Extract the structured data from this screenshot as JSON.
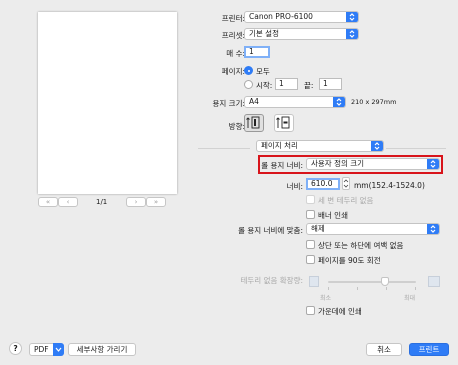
{
  "preview": {
    "page_indicator": "1/1",
    "first_page_glyph": "«",
    "prev_page_glyph": "‹",
    "next_page_glyph": "›",
    "last_page_glyph": "»"
  },
  "printer": {
    "label": "프린터:",
    "value": "Canon PRO-6100"
  },
  "preset": {
    "label": "프리셋:",
    "value": "기본 설정"
  },
  "copies": {
    "label": "매 수:",
    "value": "1"
  },
  "pages": {
    "label": "페이지:",
    "all_label": "모두",
    "from_label": "시작:",
    "from_value": "1",
    "to_label": "끝:",
    "to_value": "1"
  },
  "paper_size": {
    "label": "용지 크기:",
    "value": "A4",
    "dimensions": "210 x 297mm"
  },
  "orientation": {
    "label": "방향:"
  },
  "section": {
    "value": "페이지 처리"
  },
  "roll_width": {
    "label": "롤 용지 너비:",
    "value": "사용자 정의 크기"
  },
  "width": {
    "label": "너비:",
    "value": "610.0",
    "unit_range": "mm(152.4-1524.0)"
  },
  "options": {
    "four_side_borderless": "세 변 테두리 없음",
    "banner_print": "배너 인쇄",
    "fit_label": "롤 용지 너비에 맞춤:",
    "fit_value": "해제",
    "no_top_bottom_margin": "상단 또는 하단에 여백 없음",
    "rotate_90": "페이지를 90도 회전",
    "extension_label": "테두리 없음 확장량:",
    "extension_min": "최소",
    "extension_max": "최대",
    "print_center": "가운데에 인쇄"
  },
  "footer": {
    "help": "?",
    "pdf": "PDF",
    "hide_details": "세부사항 가리기",
    "cancel": "취소",
    "print": "프린트"
  },
  "colors": {
    "accent": "#2f7cf6",
    "highlight_border": "#d8141b"
  }
}
